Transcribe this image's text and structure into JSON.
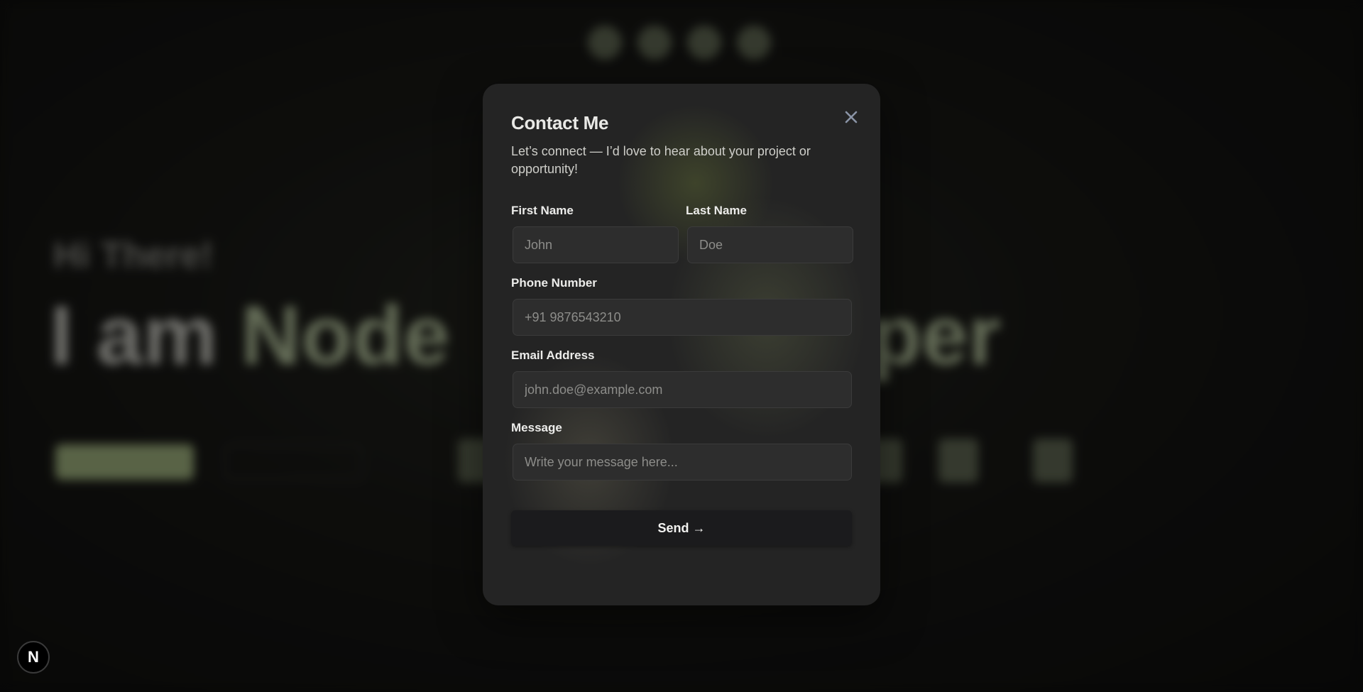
{
  "modal": {
    "title": "Contact Me",
    "subtitle": "Let’s connect — I’d love to hear about your project or opportunity!",
    "close_icon": "close-icon",
    "fields": {
      "first_name": {
        "label": "First Name",
        "placeholder": "John",
        "value": ""
      },
      "last_name": {
        "label": "Last Name",
        "placeholder": "Doe",
        "value": ""
      },
      "phone": {
        "label": "Phone Number",
        "placeholder": "+91 9876543210",
        "value": ""
      },
      "email": {
        "label": "Email Address",
        "placeholder": "john.doe@example.com",
        "value": ""
      },
      "message": {
        "label": "Message",
        "placeholder": "Write your message here...",
        "value": ""
      }
    },
    "send_label": "Send →"
  },
  "background": {
    "greeting": "Hi There!",
    "headline_prefix": "I am",
    "headline_accent": "Node",
    "headline_suffix": "oper"
  },
  "corner_badge": {
    "letter": "N",
    "icon": "nextjs-logo-icon"
  },
  "colors": {
    "modal_bg": "#242424",
    "accent_green": "#7c8a62",
    "input_bg": "#2d2d2d",
    "send_button_bg": "#1b1b1d"
  }
}
